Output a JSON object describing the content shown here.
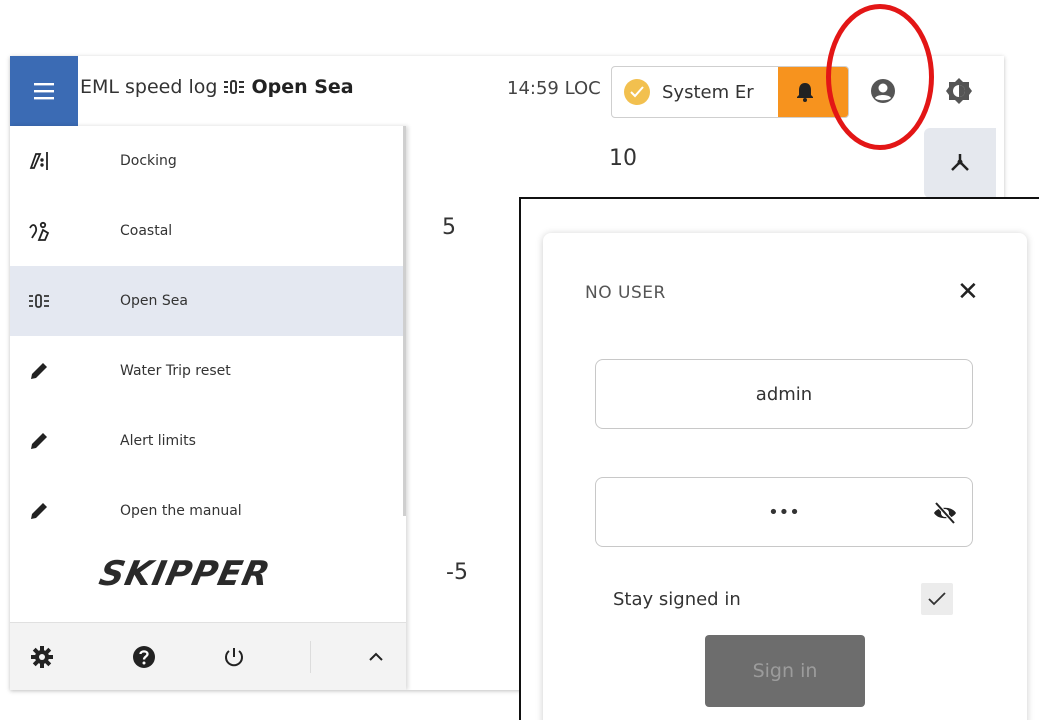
{
  "header": {
    "app_title": "EML speed log",
    "mode_icon": "open-sea-icon",
    "mode_label": "Open Sea",
    "clock": "14:59 LOC",
    "status_text": "System Er",
    "status_icon": "check-icon",
    "alert_icon": "bell-icon",
    "user_icon": "account-circle-icon",
    "theme_icon": "brightness-icon"
  },
  "sidebar": {
    "items": [
      {
        "label": "Docking",
        "icon": "docking-icon",
        "active": false
      },
      {
        "label": "Coastal",
        "icon": "coastal-icon",
        "active": false
      },
      {
        "label": "Open Sea",
        "icon": "open-sea-icon",
        "active": true
      },
      {
        "label": "Water Trip reset",
        "icon": "pencil-icon",
        "active": false
      },
      {
        "label": "Alert limits",
        "icon": "pencil-icon",
        "active": false
      },
      {
        "label": "Open the manual",
        "icon": "pencil-icon",
        "active": false
      }
    ],
    "logo": "SKIPPER",
    "footer": {
      "settings_icon": "gear-icon",
      "help_icon": "help-icon",
      "power_icon": "power-icon",
      "expand_icon": "chevron-up-icon"
    }
  },
  "gauge": {
    "labels": [
      "10",
      "5",
      "-5"
    ],
    "accent": "#f39c12"
  },
  "login": {
    "title": "NO USER",
    "username_value": "admin",
    "password_value": "•••",
    "stay_signed_in_label": "Stay signed in",
    "stay_signed_in_checked": true,
    "sign_in_label": "Sign in"
  },
  "colors": {
    "menu_button": "#3b6bb4",
    "alert_orange": "#f7931e",
    "status_check": "#f2c04f",
    "annotation": "#e31616",
    "sidebar_active": "#e4e8f1"
  }
}
